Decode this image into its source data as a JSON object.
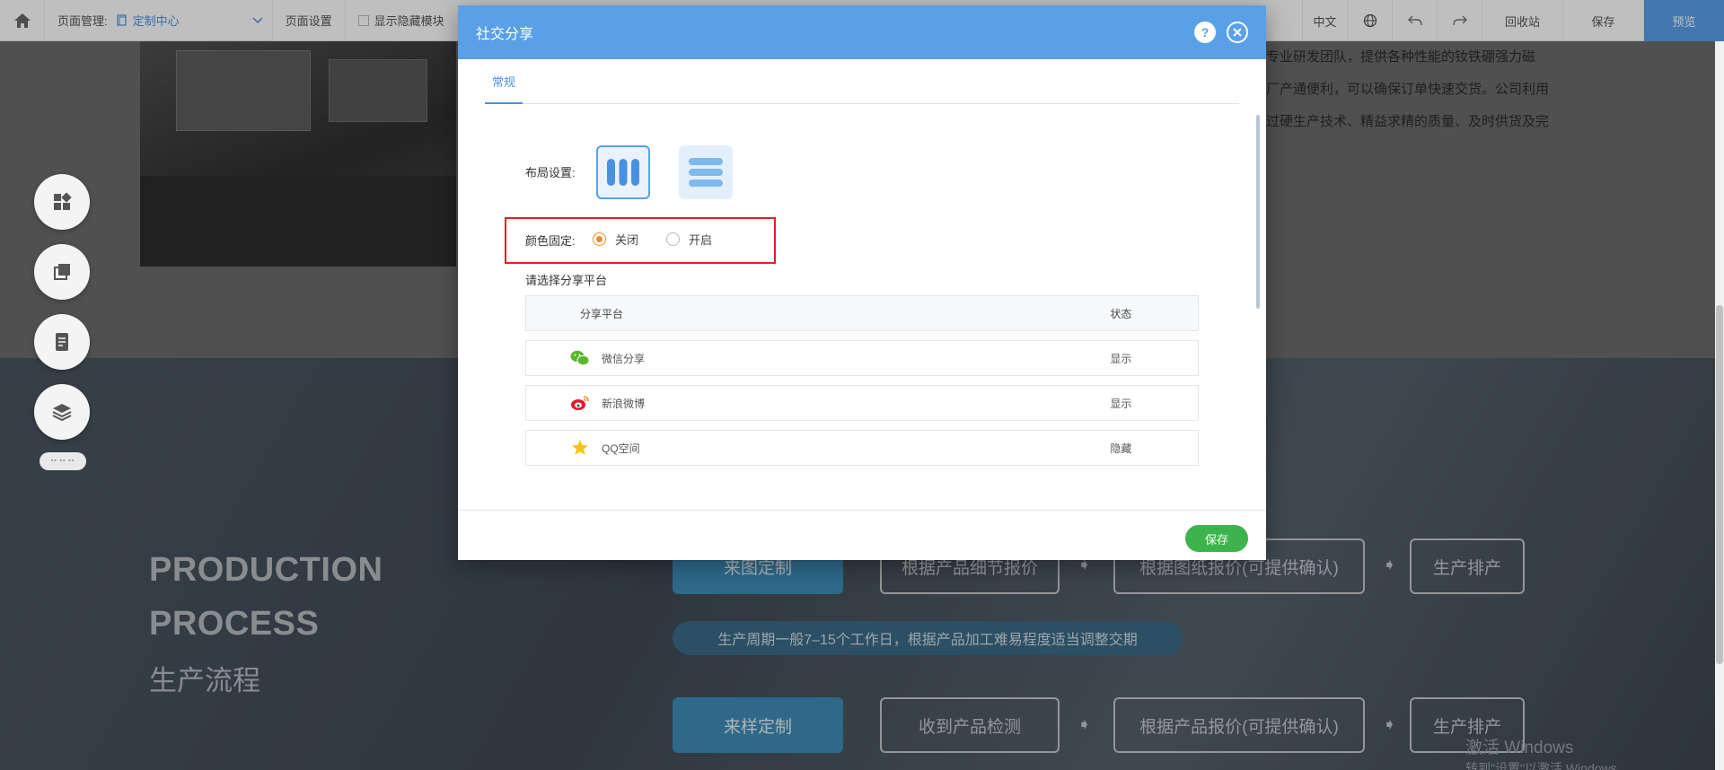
{
  "topbar": {
    "page_manage_label": "页面管理:",
    "page_select_value": "定制中心",
    "page_settings": "页面设置",
    "show_hidden": "显示隐藏模块",
    "language": "中文",
    "recycle_bin": "回收站",
    "save": "保存",
    "preview": "预览"
  },
  "background": {
    "intro_lines": [
      "专业研发团队，提供各种性能的钕铁硼强力磁",
      "厂产通便利，可以确保订单快速交货。公司利用",
      "过硬生产技术、精益求精的质量、及时供货及完"
    ],
    "process_title_1": "PRODUCTION",
    "process_title_2": "PROCESS",
    "process_subtitle": "生产流程",
    "row1": [
      "来图定制",
      "根据产品细节报价",
      "根据图纸报价(可提供确认)",
      "生产排产"
    ],
    "cycle_note": "生产周期一般7–15个工作日，根据产品加工难易程度适当调整交期",
    "row2": [
      "来样定制",
      "收到产品检测",
      "根据产品报价(可提供确认)",
      "生产排产"
    ],
    "watermark_1": "激活 Windows",
    "watermark_2": "转到\"设置\"以激活 Windows"
  },
  "modal": {
    "title": "社交分享",
    "help_glyph": "?",
    "tab_general": "常规",
    "layout_label": "布局设置:",
    "color_fixed_label": "颜色固定:",
    "radio_off": "关闭",
    "radio_on": "开启",
    "radio_selected": "关闭",
    "platform_section": "请选择分享平台",
    "table_headers": [
      "分享平台",
      "状态"
    ],
    "platforms": [
      {
        "name": "微信分享",
        "status": "显示",
        "icon": "wechat-icon"
      },
      {
        "name": "新浪微博",
        "status": "显示",
        "icon": "weibo-icon"
      },
      {
        "name": "QQ空间",
        "status": "隐藏",
        "icon": "qzone-star-icon"
      }
    ],
    "save_button": "保存"
  },
  "colors": {
    "modal_header": "#5aa0e8",
    "accent_blue": "#4a90e2",
    "radio_orange": "#f08a24",
    "highlight_red": "#e02020",
    "save_green": "#3cb44b",
    "wechat_green": "#5ab72d",
    "weibo_red": "#e6162d",
    "qzone_yellow": "#f8c218"
  }
}
